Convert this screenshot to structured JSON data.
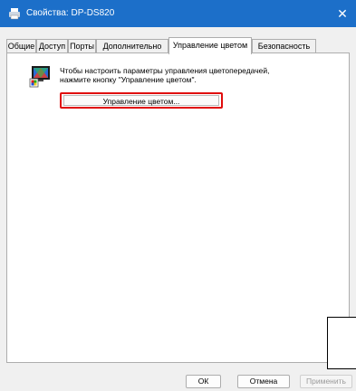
{
  "window": {
    "title": "Свойства: DP-DS820",
    "close_symbol": "✕"
  },
  "tabs": [
    {
      "label": "Общие",
      "active": false
    },
    {
      "label": "Доступ",
      "active": false
    },
    {
      "label": "Порты",
      "active": false
    },
    {
      "label": "Дополнительно",
      "active": false
    },
    {
      "label": "Управление цветом",
      "active": true
    },
    {
      "label": "Безопасность",
      "active": false
    }
  ],
  "color_management": {
    "description_line1": "Чтобы настроить параметры управления цветопередачей,",
    "description_line2": "нажмите кнопку \"Управление цветом\".",
    "button_label": "Управление цветом..."
  },
  "footer": {
    "ok_label": "ОК",
    "cancel_label": "Отмена",
    "apply_label": "Применить"
  },
  "colors": {
    "titlebar": "#1c6fc9",
    "highlight_border": "#e00d0d"
  }
}
